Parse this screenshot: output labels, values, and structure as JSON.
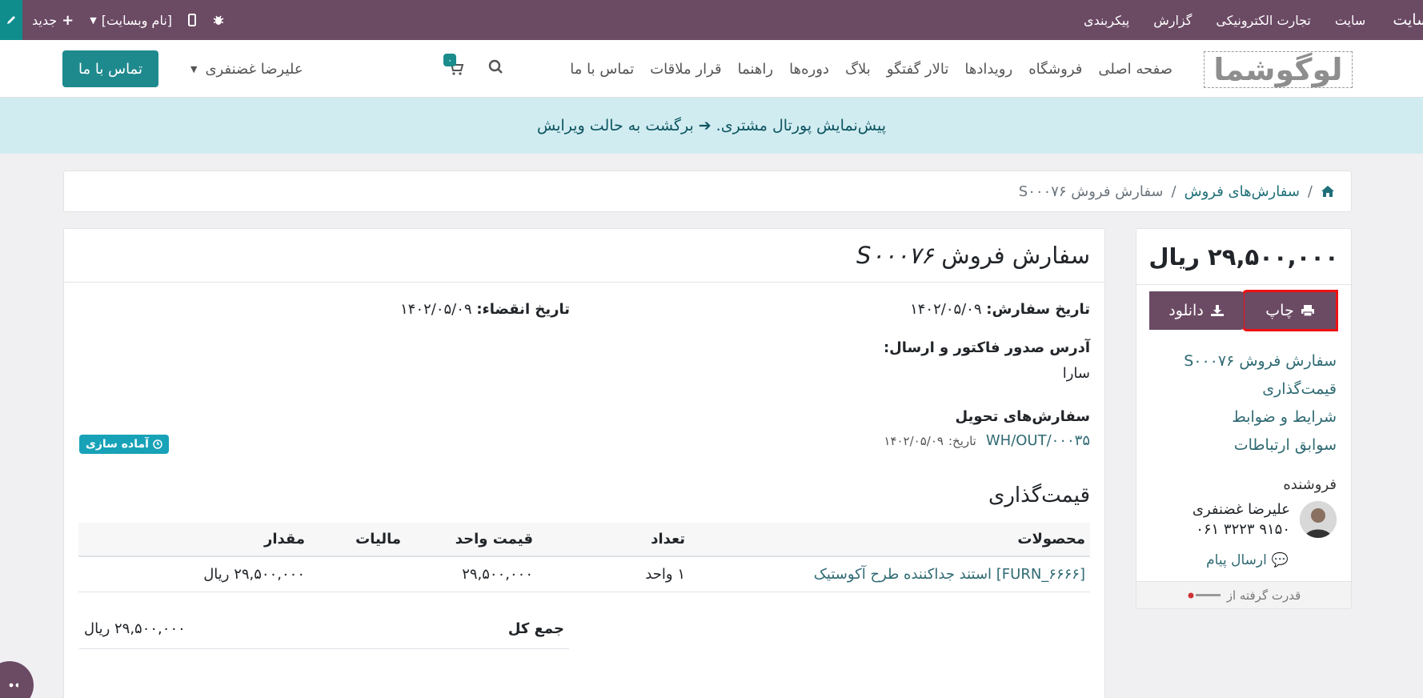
{
  "admin_bar": {
    "new_label": "جدید",
    "website_name": "[نام وبسایت]",
    "menu": [
      "سایت",
      "سایت",
      "تجارت الکترونیکی",
      "گزارش",
      "پیکربندی"
    ]
  },
  "header": {
    "logo_text": "لوگوشما",
    "nav": [
      "صفحه اصلی",
      "فروشگاه",
      "رویدادها",
      "تالار گفتگو",
      "بلاگ",
      "دوره‌ها",
      "راهنما",
      "قرار ملاقات",
      "تماس با ما"
    ],
    "cart_count": "۰",
    "user_name": "علیرضا غضنفری",
    "contact_button": "تماس با ما"
  },
  "banner": {
    "text": "پیش‌نمایش پورتال مشتری.",
    "link": "برگشت به حالت ویرایش"
  },
  "breadcrumb": {
    "sep": "/",
    "orders_link": "سفارش‌های فروش",
    "current": "سفارش فروش S۰۰۰۷۶"
  },
  "sidebar": {
    "total": "۲۹,۵۰۰,۰۰۰ ریال",
    "download_label": "دانلود",
    "print_label": "چاپ",
    "links": [
      "سفارش فروش S۰۰۰۷۶",
      "قیمت‌گذاری",
      "شرایط و ضوابط",
      "سوابق ارتباطات"
    ],
    "seller_label": "فروشنده",
    "seller_name": "علیرضا غضنفری",
    "seller_phone": "۰۶۱ ۳۲۲۳ ۹۱۵۰",
    "send_message": "ارسال پیام",
    "powered_by": "قدرت گرفته از"
  },
  "order": {
    "title_prefix": "سفارش فروش",
    "code": "S۰۰۰۷۶",
    "order_date_label": "تاریخ سفارش:",
    "order_date": "۱۴۰۲/۰۵/۰۹",
    "expiry_label": "تاریخ انقضاء:",
    "expiry_date": "۱۴۰۲/۰۵/۰۹",
    "address_label": "آدرس صدور فاکتور و ارسال:",
    "address_name": "سارا",
    "delivery_label": "سفارش‌های تحویل",
    "delivery_ref": "WH/OUT/۰۰۰۳۵",
    "delivery_date_label": "تاریخ:",
    "delivery_date": "۱۴۰۲/۰۵/۰۹",
    "status": "آماده سازی",
    "pricing_title": "قیمت‌گذاری",
    "columns": [
      "محصولات",
      "تعداد",
      "قیمت واحد",
      "مالیات",
      "مقدار"
    ],
    "rows": [
      {
        "product": "[FURN_۶۶۶۶] استند جداکننده طرح آکوستیک",
        "qty": "۱ واحد",
        "unit_price": "۲۹,۵۰۰,۰۰۰",
        "tax": "",
        "amount": "۲۹,۵۰۰,۰۰۰ ریال"
      }
    ],
    "total_label": "جمع کل",
    "total_value": "۲۹,۵۰۰,۰۰۰ ریال"
  }
}
